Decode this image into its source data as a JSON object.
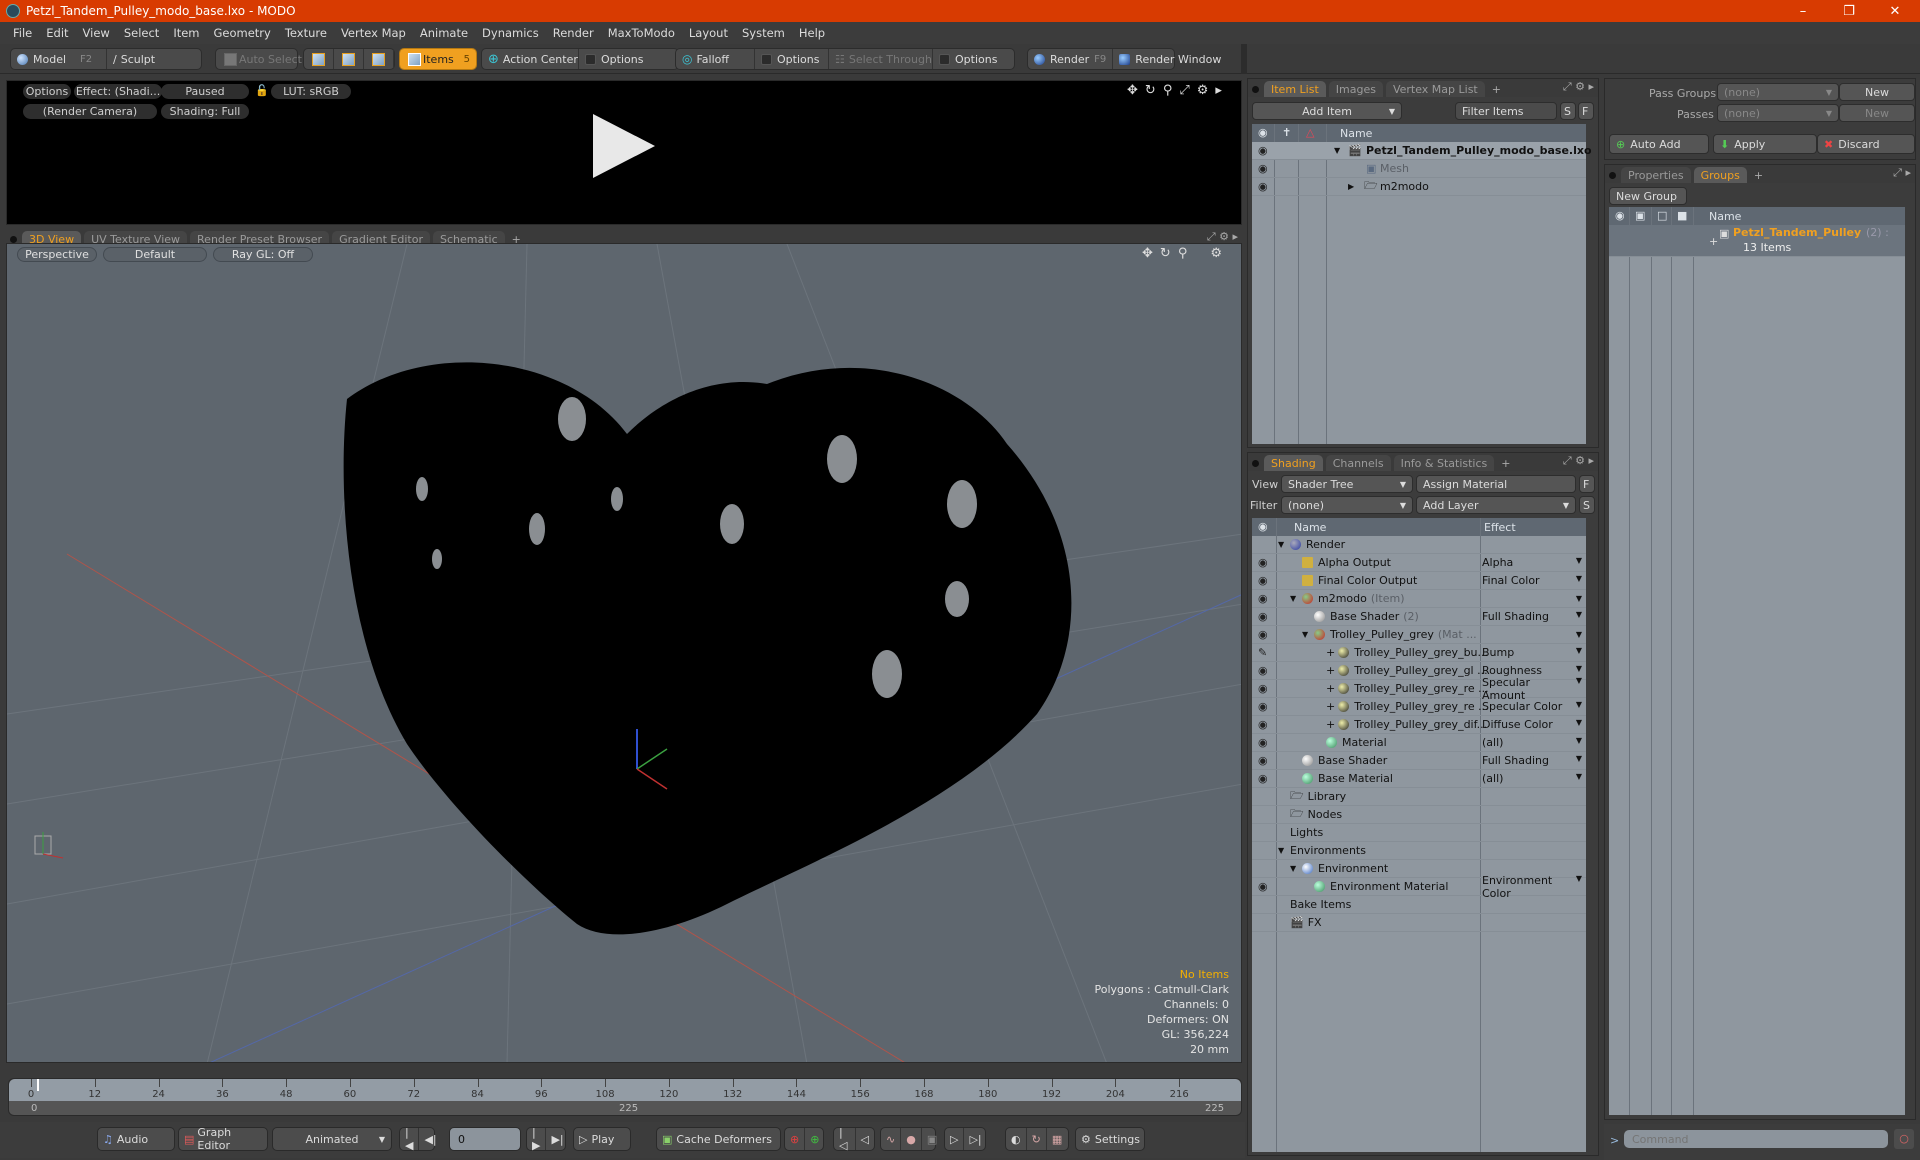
{
  "window": {
    "title": "Petzl_Tandem_Pulley_modo_base.lxo - MODO",
    "controls": [
      "minimize",
      "restore",
      "close"
    ]
  },
  "menu": [
    "File",
    "Edit",
    "View",
    "Select",
    "Item",
    "Geometry",
    "Texture",
    "Vertex Map",
    "Animate",
    "Dynamics",
    "Render",
    "MaxToModo",
    "Layout",
    "System",
    "Help"
  ],
  "toolbar": {
    "model": "Model",
    "model_key": "F2",
    "sculpt": "Sculpt",
    "auto_select": "Auto Select",
    "items": "Items",
    "items_key": "5",
    "action_center": "Action Center",
    "options1": "Options",
    "falloff": "Falloff",
    "options2": "Options",
    "select_through": "Select Through",
    "options3": "Options",
    "render": "Render",
    "render_key": "F9",
    "render_window": "Render Window"
  },
  "render_preview": {
    "options": "Options",
    "effect": "Effect: (Shadi...",
    "status": "Paused",
    "lut": "LUT: sRGB",
    "camera": "(Render Camera)",
    "shading": "Shading: Full"
  },
  "viewport_tabs": [
    "3D View",
    "UV Texture View",
    "Render Preset Browser",
    "Gradient Editor",
    "Schematic"
  ],
  "viewport": {
    "projection": "Perspective",
    "style": "Default",
    "raygl": "Ray GL: Off",
    "stats": {
      "selection": "No Items",
      "polygons": "Polygons : Catmull-Clark",
      "channels": "Channels: 0",
      "deformers": "Deformers: ON",
      "gl": "GL: 356,224",
      "scale": "20 mm"
    }
  },
  "timeline": {
    "ticks": [
      "0",
      "12",
      "24",
      "36",
      "48",
      "60",
      "72",
      "84",
      "96",
      "108",
      "120",
      "132",
      "144",
      "156",
      "168",
      "180",
      "192",
      "204",
      "216"
    ],
    "start": "0",
    "end": "225",
    "mid": "225"
  },
  "transport": {
    "audio": "Audio",
    "graph_editor": "Graph Editor",
    "mode": "Animated",
    "frame": "0",
    "play": "Play",
    "cache_deformers": "Cache Deformers",
    "settings": "Settings"
  },
  "item_list": {
    "tabs": [
      "Item List",
      "Images",
      "Vertex Map List"
    ],
    "add_item": "Add Item",
    "filter": "Filter Items",
    "s": "S",
    "f": "F",
    "header": "Name",
    "rows": [
      {
        "name": "Petzl_Tandem_Pulley_modo_base.lxo",
        "kind": "scene"
      },
      {
        "name": "Mesh",
        "kind": "mesh"
      },
      {
        "name": "m2modo",
        "kind": "group"
      }
    ]
  },
  "shading": {
    "tabs": [
      "Shading",
      "Channels",
      "Info & Statistics"
    ],
    "view_label": "View",
    "view_value": "Shader Tree",
    "assign_material": "Assign Material",
    "filter_label": "Filter",
    "filter_value": "(none)",
    "add_layer": "Add Layer",
    "f": "F",
    "s": "S",
    "headers": {
      "name": "Name",
      "effect": "Effect"
    },
    "rows": [
      {
        "name": "Render",
        "suffix": "",
        "effect": "",
        "indent": 0
      },
      {
        "name": "Alpha Output",
        "suffix": "",
        "effect": "Alpha",
        "indent": 1
      },
      {
        "name": "Final Color Output",
        "suffix": "",
        "effect": "Final Color",
        "indent": 1
      },
      {
        "name": "m2modo",
        "suffix": "(Item)",
        "effect": "",
        "indent": 1
      },
      {
        "name": "Base Shader",
        "suffix": "(2)",
        "effect": "Full Shading",
        "indent": 2
      },
      {
        "name": "Trolley_Pulley_grey",
        "suffix": "(Mat ...",
        "effect": "",
        "indent": 2
      },
      {
        "name": "Trolley_Pulley_grey_bu...",
        "suffix": "",
        "effect": "Bump",
        "indent": 3
      },
      {
        "name": "Trolley_Pulley_grey_gl ...",
        "suffix": "",
        "effect": "Roughness",
        "indent": 3
      },
      {
        "name": "Trolley_Pulley_grey_re ...",
        "suffix": "",
        "effect": "Specular Amount",
        "indent": 3
      },
      {
        "name": "Trolley_Pulley_grey_re ...",
        "suffix": "",
        "effect": "Specular Color",
        "indent": 3
      },
      {
        "name": "Trolley_Pulley_grey_dif...",
        "suffix": "",
        "effect": "Diffuse Color",
        "indent": 3
      },
      {
        "name": "Material",
        "suffix": "",
        "effect": "(all)",
        "indent": 3
      },
      {
        "name": "Base Shader",
        "suffix": "",
        "effect": "Full Shading",
        "indent": 1
      },
      {
        "name": "Base Material",
        "suffix": "",
        "effect": "(all)",
        "indent": 1
      },
      {
        "name": "Library",
        "suffix": "",
        "effect": "",
        "indent": 0
      },
      {
        "name": "Nodes",
        "suffix": "",
        "effect": "",
        "indent": 0
      },
      {
        "name": "Lights",
        "suffix": "",
        "effect": "",
        "indent": 0
      },
      {
        "name": "Environments",
        "suffix": "",
        "effect": "",
        "indent": 0
      },
      {
        "name": "Environment",
        "suffix": "",
        "effect": "",
        "indent": 1
      },
      {
        "name": "Environment Material",
        "suffix": "",
        "effect": "Environment Color",
        "indent": 2
      },
      {
        "name": "Bake Items",
        "suffix": "",
        "effect": "",
        "indent": 0
      },
      {
        "name": "FX",
        "suffix": "",
        "effect": "",
        "indent": 0
      }
    ]
  },
  "passes": {
    "pass_groups_label": "Pass Groups",
    "pass_groups_value": "(none)",
    "new1": "New",
    "passes_label": "Passes",
    "passes_value": "(none)",
    "new2": "New",
    "auto_add": "Auto Add",
    "apply": "Apply",
    "discard": "Discard"
  },
  "groups": {
    "tabs": [
      "Properties",
      "Groups"
    ],
    "new_group": "New Group",
    "header": "Name",
    "rows": [
      {
        "name": "Petzl_Tandem_Pulley",
        "count": "(2) :",
        "sub": "13 Items"
      }
    ]
  },
  "command": {
    "prompt": ">",
    "placeholder": "Command"
  },
  "colors": {
    "accent": "#f0a020",
    "titlebar": "#d83b01",
    "viewport_bg": "#5e666e"
  }
}
